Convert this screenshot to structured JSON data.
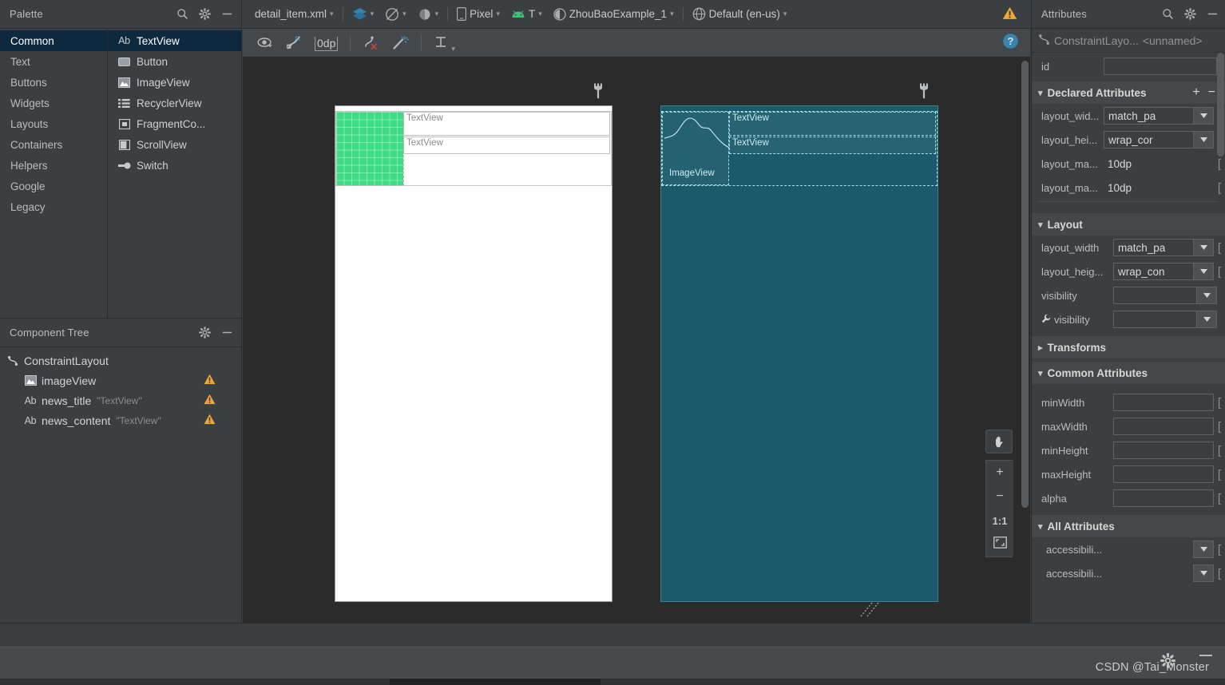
{
  "palette": {
    "title": "Palette",
    "icons": [
      "search-icon",
      "gear-icon",
      "minimize-icon"
    ],
    "categories": [
      {
        "label": "Common",
        "selected": true
      },
      {
        "label": "Text",
        "selected": false
      },
      {
        "label": "Buttons",
        "selected": false
      },
      {
        "label": "Widgets",
        "selected": false
      },
      {
        "label": "Layouts",
        "selected": false
      },
      {
        "label": "Containers",
        "selected": false
      },
      {
        "label": "Helpers",
        "selected": false
      },
      {
        "label": "Google",
        "selected": false
      },
      {
        "label": "Legacy",
        "selected": false
      }
    ],
    "items": [
      {
        "label": "TextView",
        "icon": "textview-icon",
        "selected": true
      },
      {
        "label": "Button",
        "icon": "button-icon",
        "selected": false
      },
      {
        "label": "ImageView",
        "icon": "imageview-icon",
        "selected": false
      },
      {
        "label": "RecyclerView",
        "icon": "recyclerview-icon",
        "selected": false
      },
      {
        "label": "FragmentCo...",
        "icon": "fragment-container-icon",
        "selected": false
      },
      {
        "label": "ScrollView",
        "icon": "scrollview-icon",
        "selected": false
      },
      {
        "label": "Switch",
        "icon": "switch-icon",
        "selected": false
      }
    ]
  },
  "component_tree": {
    "title": "Component Tree",
    "icons": [
      "gear-icon",
      "minimize-icon"
    ],
    "nodes": [
      {
        "icon": "constraintlayout-icon",
        "name": "ConstraintLayout",
        "value": "",
        "warning": false,
        "indent": 0
      },
      {
        "icon": "imageview-icon",
        "name": "imageView",
        "value": "",
        "warning": true,
        "indent": 1
      },
      {
        "icon": "textview-icon",
        "name": "news_title",
        "value": "\"TextView\"",
        "warning": true,
        "indent": 1
      },
      {
        "icon": "textview-icon",
        "name": "news_content",
        "value": "\"TextView\"",
        "warning": true,
        "indent": 1
      }
    ]
  },
  "editor_toolbar": {
    "file_name": "detail_item.xml",
    "view_mode_icon": "layers-icon",
    "orientation_icon": "rotate-icon",
    "theme_icon": "theme-icon",
    "device": "Pixel",
    "api_level": "T",
    "theme": "ZhouBaoExample_1",
    "locale": "Default (en-us)",
    "warning_icon": "warning-icon"
  },
  "constraint_toolbar": {
    "visibility_icon": "eye-icon",
    "autoconnect_icon": "autoconnect-off-icon",
    "margin_value": "0dp",
    "clear_constraints_icon": "clear-constraints-icon",
    "infer_constraints_icon": "magic-wand-icon",
    "guidelines_icon": "guidelines-icon",
    "help_icon": "help-icon"
  },
  "canvas": {
    "design_surface_label": "design-surface",
    "blueprint_surface_label": "blueprint-surface",
    "design_widgets": {
      "imageview_label": "",
      "textview_1": "TextView",
      "textview_2": "TextView"
    },
    "blueprint_widgets": {
      "imageview_label": "ImageView",
      "textview_1": "TextView",
      "textview_2": "TextView"
    },
    "zoom_controls": {
      "pan_icon": "hand-pan-icon",
      "zoom_in": "+",
      "zoom_out": "−",
      "zoom_actual": "1:1",
      "zoom_fit_icon": "zoom-to-fit-icon"
    }
  },
  "attributes": {
    "title": "Attributes",
    "icons": [
      "search-icon",
      "gear-icon",
      "minimize-icon"
    ],
    "selected_component_type": "ConstraintLayo...",
    "selected_component_id": "<unnamed>",
    "id_label": "id",
    "id_value": "",
    "declared_section": {
      "title": "Declared Attributes",
      "add_label": "+",
      "remove_label": "−",
      "rows": [
        {
          "key": "layout_wid...",
          "value": "match_pa",
          "type": "combo"
        },
        {
          "key": "layout_hei...",
          "value": "wrap_cor",
          "type": "combo"
        },
        {
          "key": "layout_ma...",
          "value": "10dp",
          "type": "text"
        },
        {
          "key": "layout_ma...",
          "value": "10dp",
          "type": "text"
        }
      ]
    },
    "layout_section": {
      "title": "Layout",
      "rows": [
        {
          "key": "layout_width",
          "value": "match_pa",
          "type": "combo"
        },
        {
          "key": "layout_heig...",
          "value": "wrap_con",
          "type": "combo"
        },
        {
          "key": "visibility",
          "value": "",
          "type": "combo"
        },
        {
          "key": "visibility",
          "value": "",
          "type": "combo",
          "icon": "wrench-icon"
        }
      ]
    },
    "transforms_section": {
      "title": "Transforms",
      "collapsed": true
    },
    "common_section": {
      "title": "Common Attributes",
      "rows": [
        {
          "key": "minWidth",
          "value": "",
          "type": "text"
        },
        {
          "key": "maxWidth",
          "value": "",
          "type": "text"
        },
        {
          "key": "minHeight",
          "value": "",
          "type": "text"
        },
        {
          "key": "maxHeight",
          "value": "",
          "type": "text"
        },
        {
          "key": "alpha",
          "value": "",
          "type": "text"
        }
      ]
    },
    "all_section": {
      "title": "All Attributes",
      "rows": [
        {
          "key": "accessibili...",
          "value": "",
          "type": "combo"
        },
        {
          "key": "accessibili...",
          "value": "",
          "type": "combo"
        }
      ]
    }
  },
  "statusbar": {
    "watermark": "CSDN @Tai_Monster",
    "gear_icon": "gear-icon",
    "minimize_icon": "minimize-icon"
  },
  "colors": {
    "panel_bg": "#3c3f41",
    "canvas_bg": "#2b2b2b",
    "selection_blue": "#0d293e",
    "blueprint_teal": "#1b5a6b",
    "android_green": "#3ddc84",
    "warning_amber": "#f0a732",
    "accent_blue": "#3592c4"
  }
}
